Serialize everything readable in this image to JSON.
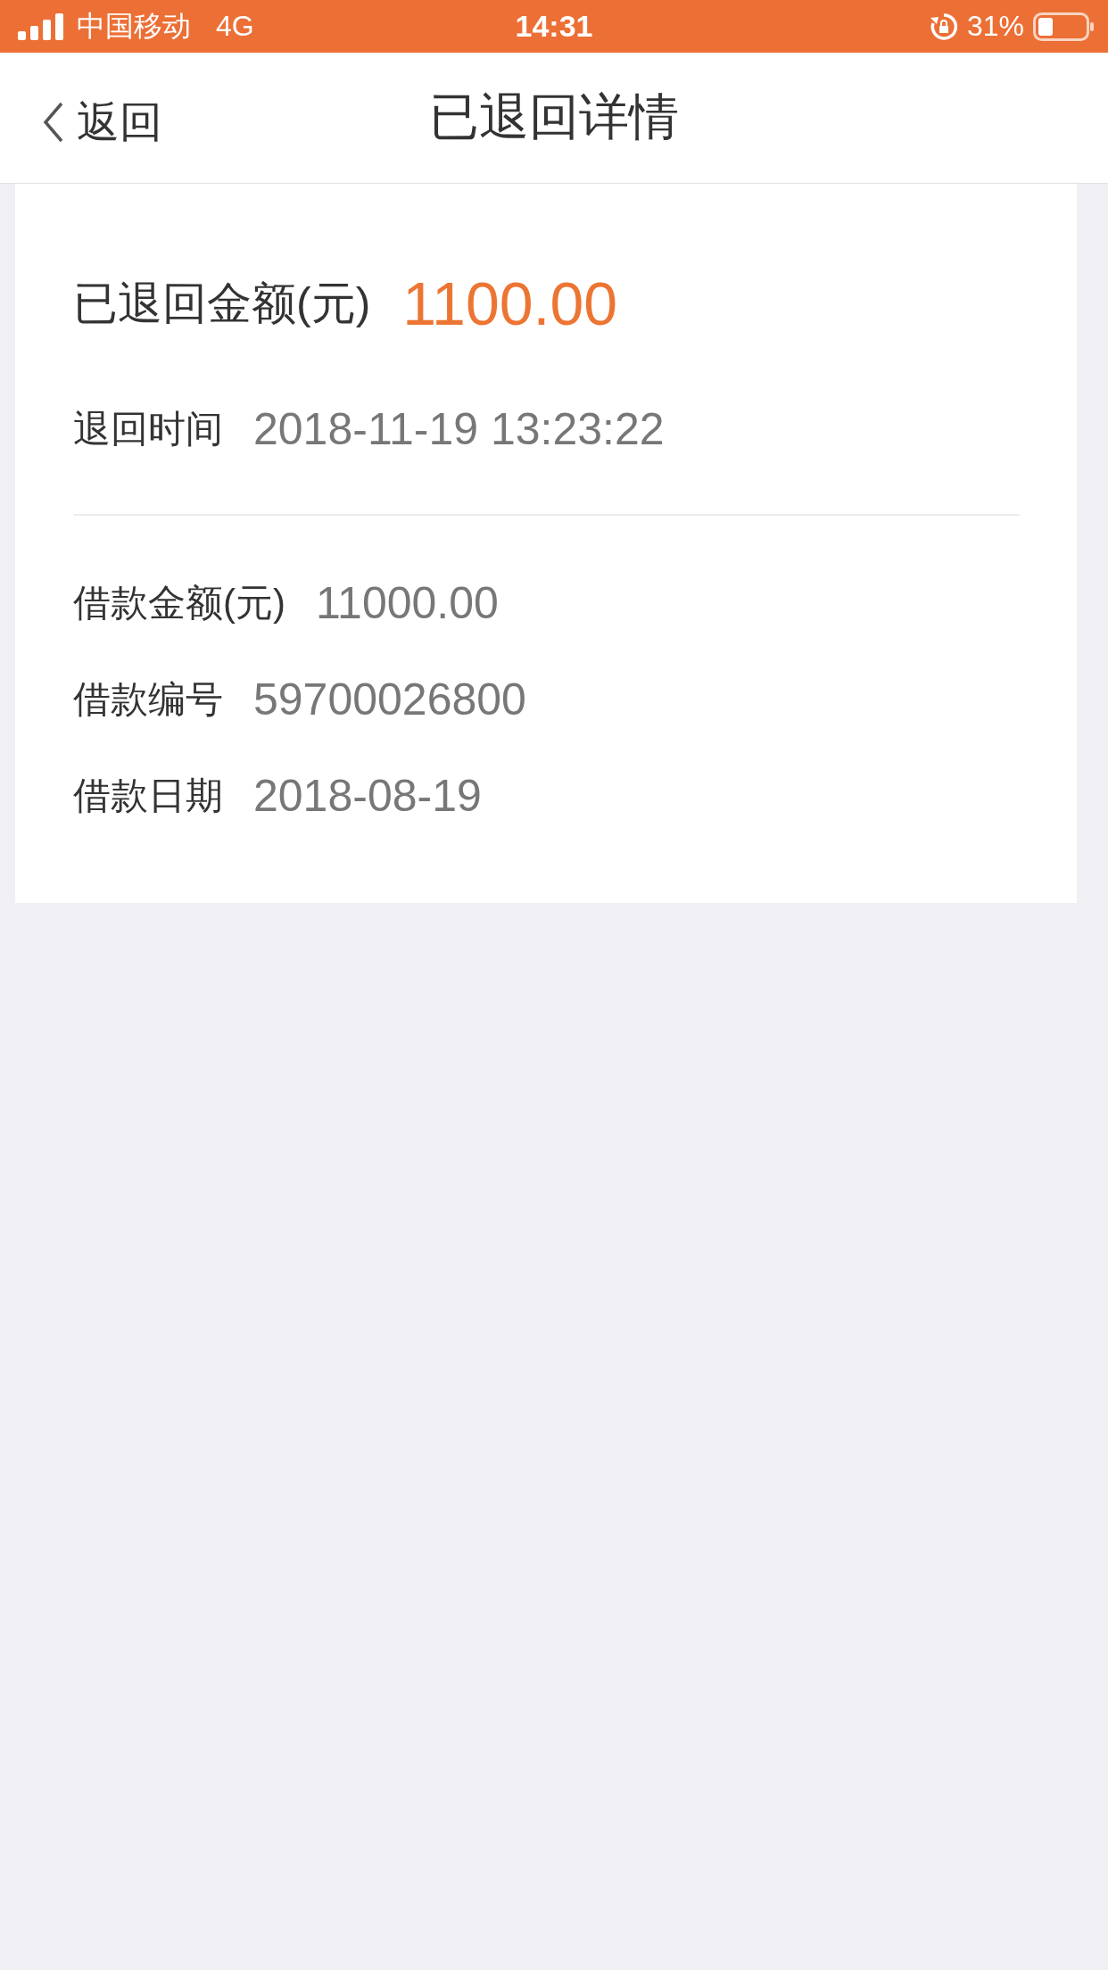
{
  "status_bar": {
    "carrier": "中国移动",
    "network": "4G",
    "time": "14:31",
    "battery": "31%"
  },
  "nav": {
    "back": "返回",
    "title": "已退回详情"
  },
  "summary": {
    "label": "已退回金额(元)",
    "amount": "1100.00"
  },
  "returned": {
    "label": "退回时间",
    "value": "2018-11-19 13:23:22"
  },
  "details": [
    {
      "label": "借款金额(元)",
      "value": "11000.00"
    },
    {
      "label": "借款编号",
      "value": "59700026800"
    },
    {
      "label": "借款日期",
      "value": "2018-08-19"
    }
  ]
}
